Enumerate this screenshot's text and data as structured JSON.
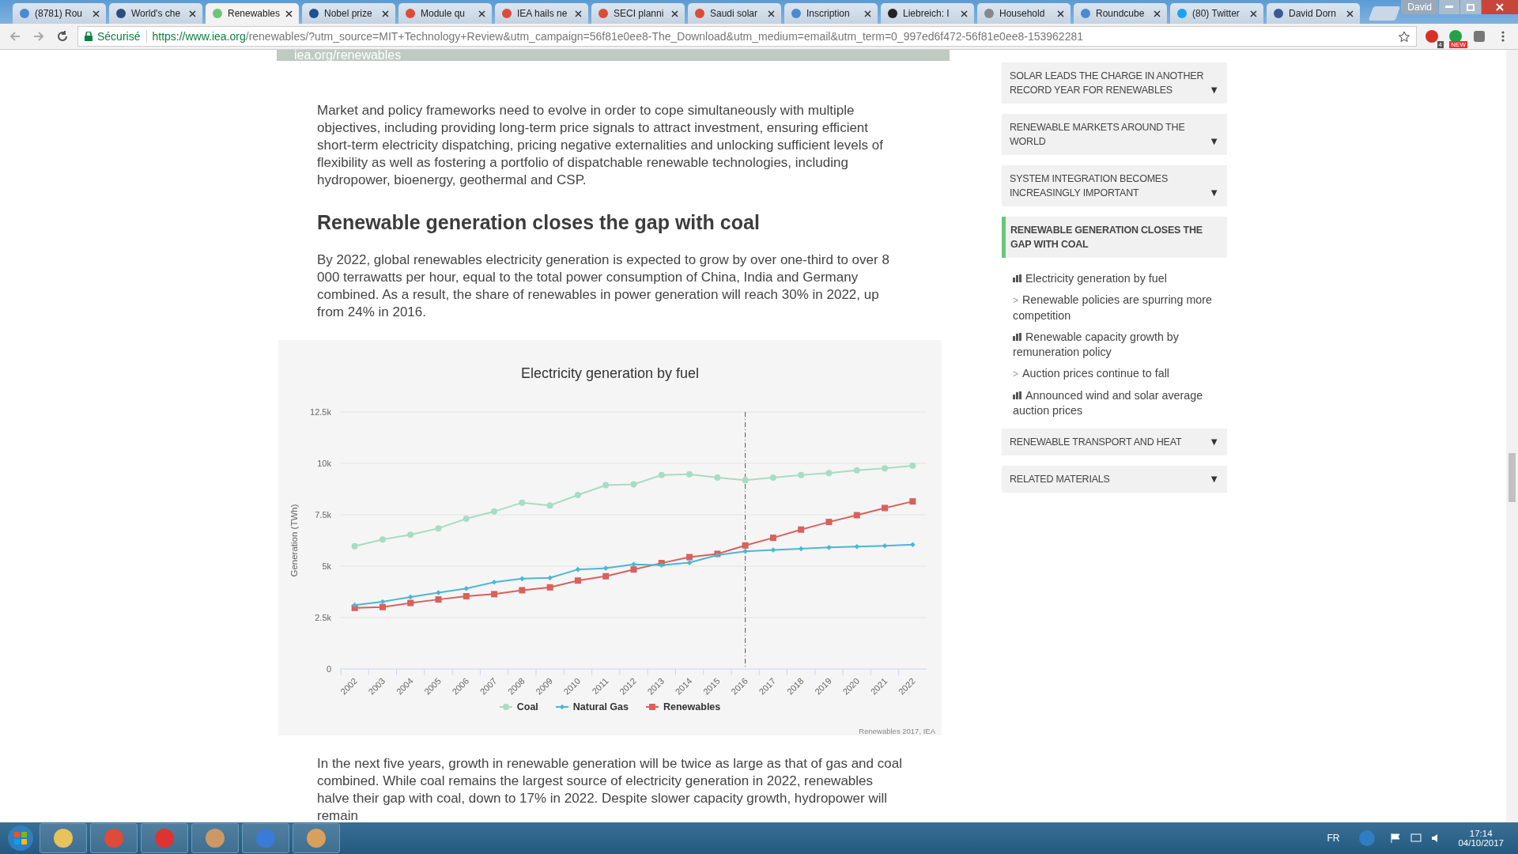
{
  "browser": {
    "tabs": [
      {
        "title": "(8781) Rou",
        "selected": false
      },
      {
        "title": "World's che",
        "selected": false
      },
      {
        "title": "Renewables",
        "selected": true
      },
      {
        "title": "Nobel prize",
        "selected": false
      },
      {
        "title": "Module qu",
        "selected": false
      },
      {
        "title": "IEA hails ne",
        "selected": false
      },
      {
        "title": "SECI planni",
        "selected": false
      },
      {
        "title": "Saudi solar",
        "selected": false
      },
      {
        "title": "Inscription",
        "selected": false
      },
      {
        "title": "Liebreich: I",
        "selected": false
      },
      {
        "title": "Household",
        "selected": false
      },
      {
        "title": "Roundcube",
        "selected": false
      },
      {
        "title": "(80) Twitter",
        "selected": false
      },
      {
        "title": "David Dorn",
        "selected": false
      }
    ],
    "profile": "David",
    "secure_label": "Sécurisé",
    "url": {
      "host": "https://www.iea.org",
      "path": "/renewables/?utm_source=MIT+Technology+Review&utm_campaign=56f81e0ee8-The_Download&utm_medium=email&utm_term=0_997ed6f472-56f81e0ee8-153962281"
    },
    "extensions": [
      {
        "badge": "4"
      },
      {
        "badge": "NEW"
      }
    ]
  },
  "banner": {
    "text": "iea.org/renewables"
  },
  "article": {
    "paragraphs_top": [
      "Market and policy frameworks need to evolve in order to cope simultaneously with multiple objectives, including providing long-term price signals to attract investment, ensuring efficient short-term electricity dispatching, pricing negative externalities and unlocking sufficient levels of flexibility as well as fostering a portfolio of dispatchable renewable technologies, including hydropower, bioenergy, geothermal and CSP."
    ],
    "heading": "Renewable generation closes the gap with coal",
    "paragraphs_mid": [
      "By 2022, global renewables electricity generation is expected to grow by over one-third to over 8 000 terrawatts per hour, equal to the total power consumption of China, India and Germany combined. As a result, the share of renewables in power generation will reach 30% in 2022, up from 24% in 2016."
    ],
    "chart": {
      "source": "Renewables 2017, IEA",
      "chart_data": {
        "type": "line",
        "title": "Electricity generation by fuel",
        "ylabel": "Generation (TWh)",
        "categories": [
          "2002",
          "2003",
          "2004",
          "2005",
          "2006",
          "2007",
          "2008",
          "2009",
          "2010",
          "2011",
          "2012",
          "2013",
          "2014",
          "2015",
          "2016",
          "2017",
          "2018",
          "2019",
          "2020",
          "2021",
          "2022"
        ],
        "ylim": [
          0,
          12500
        ],
        "yticks": [
          {
            "value": 0,
            "label": "0"
          },
          {
            "value": 2500,
            "label": "2.5k"
          },
          {
            "value": 5000,
            "label": "5k"
          },
          {
            "value": 7500,
            "label": "7.5k"
          },
          {
            "value": 10000,
            "label": "10k"
          },
          {
            "value": 12500,
            "label": "12.5k"
          }
        ],
        "series": [
          {
            "name": "Coal",
            "color": "#a8dcc4",
            "marker": "circle",
            "values": [
              5970,
              6300,
              6530,
              6840,
              7310,
              7660,
              8090,
              7950,
              8460,
              8940,
              8980,
              9430,
              9470,
              9310,
              9180,
              9310,
              9430,
              9530,
              9660,
              9760,
              9880
            ]
          },
          {
            "name": "Natural Gas",
            "color": "#4db6d4",
            "marker": "diamond",
            "values": [
              3110,
              3270,
              3500,
              3710,
              3910,
              4220,
              4390,
              4430,
              4840,
              4900,
              5090,
              5050,
              5170,
              5540,
              5720,
              5790,
              5850,
              5910,
              5950,
              5990,
              6050
            ]
          },
          {
            "name": "Renewables",
            "color": "#d9605c",
            "marker": "square",
            "values": [
              2970,
              3010,
              3210,
              3380,
              3540,
              3640,
              3830,
              3970,
              4300,
              4510,
              4840,
              5150,
              5440,
              5600,
              6010,
              6380,
              6780,
              7150,
              7480,
              7830,
              8150
            ]
          }
        ],
        "grid": true,
        "legend": "bottom",
        "ref_lines": [
          {
            "axis": "x",
            "value": "2016",
            "color": "#555555"
          }
        ]
      }
    },
    "paragraphs_bottom": [
      "In the next five years, growth in renewable generation will be twice as large as that of gas and coal combined. While coal remains the largest source of electricity generation in 2022, renewables halve their gap with coal, down to 17% in 2022. Despite slower capacity growth, hydropower will remain"
    ]
  },
  "sidebar": {
    "sections": [
      {
        "title": "SOLAR LEADS THE CHARGE IN ANOTHER RECORD YEAR FOR RENEWABLES",
        "selected": false,
        "arrow": "▼"
      },
      {
        "title": "RENEWABLE MARKETS AROUND THE WORLD",
        "selected": false,
        "arrow": "▼"
      },
      {
        "title": "SYSTEM INTEGRATION BECOMES INCREASINGLY IMPORTANT",
        "selected": false,
        "arrow": "▼"
      },
      {
        "title": "RENEWABLE GENERATION CLOSES THE GAP WITH COAL",
        "selected": true,
        "children": [
          {
            "kind": "chart",
            "label": "Electricity generation by fuel"
          },
          {
            "kind": "link",
            "marker": ">",
            "label": "Renewable policies are spurring more competition"
          },
          {
            "kind": "chart",
            "label": "Renewable capacity growth by remuneration policy"
          },
          {
            "kind": "link",
            "marker": ">",
            "label": "Auction prices continue to fall"
          },
          {
            "kind": "chart",
            "label": "Announced wind and solar average auction prices"
          }
        ]
      },
      {
        "title": "RENEWABLE TRANSPORT AND HEAT",
        "selected": false,
        "arrow": "▼"
      },
      {
        "title": "RELATED MATERIALS",
        "selected": false,
        "arrow": "▼"
      }
    ]
  },
  "taskbar": {
    "language": "FR",
    "time": "17:14",
    "date": "04/10/2017"
  }
}
